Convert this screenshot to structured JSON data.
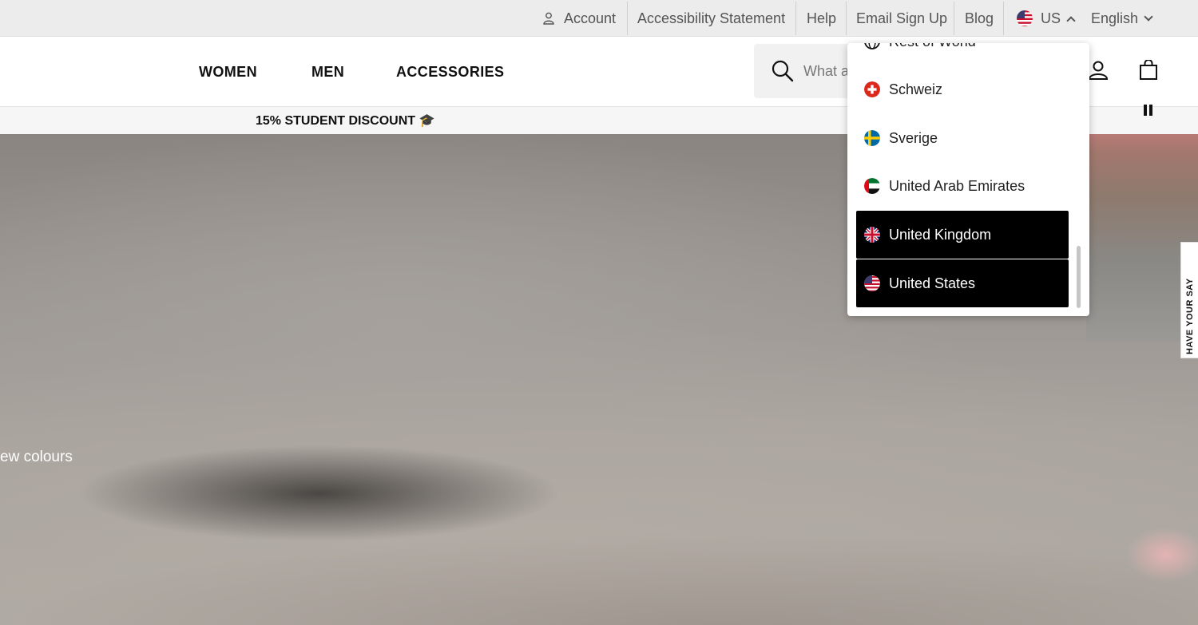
{
  "utility_bar": {
    "account": "Account",
    "accessibility": "Accessibility Statement",
    "help": "Help",
    "email_signup": "Email Sign Up",
    "blog": "Blog",
    "region": "US",
    "language": "English"
  },
  "main_nav": {
    "items": [
      "WOMEN",
      "MEN",
      "ACCESSORIES"
    ],
    "search_placeholder": "What a"
  },
  "promo": {
    "text": "15% STUDENT DISCOUNT 🎓"
  },
  "hero": {
    "caption": "ew colours"
  },
  "feedback_tab": {
    "label": "HAVE YOUR SAY"
  },
  "country_dropdown": {
    "options": [
      {
        "label": "Rest of World",
        "flag": "globe-icon",
        "selected": false
      },
      {
        "label": "Schweiz",
        "flag": "swiss-flag-icon",
        "selected": false
      },
      {
        "label": "Sverige",
        "flag": "swedish-flag-icon",
        "selected": false
      },
      {
        "label": "United Arab Emirates",
        "flag": "uae-flag-icon",
        "selected": false
      },
      {
        "label": "United Kingdom",
        "flag": "uk-flag-icon",
        "selected": true
      },
      {
        "label": "United States",
        "flag": "us-flag-icon",
        "selected": true
      }
    ]
  },
  "colors": {
    "accent": "#000000",
    "utility_bg": "#ececec",
    "text": "#555555"
  }
}
